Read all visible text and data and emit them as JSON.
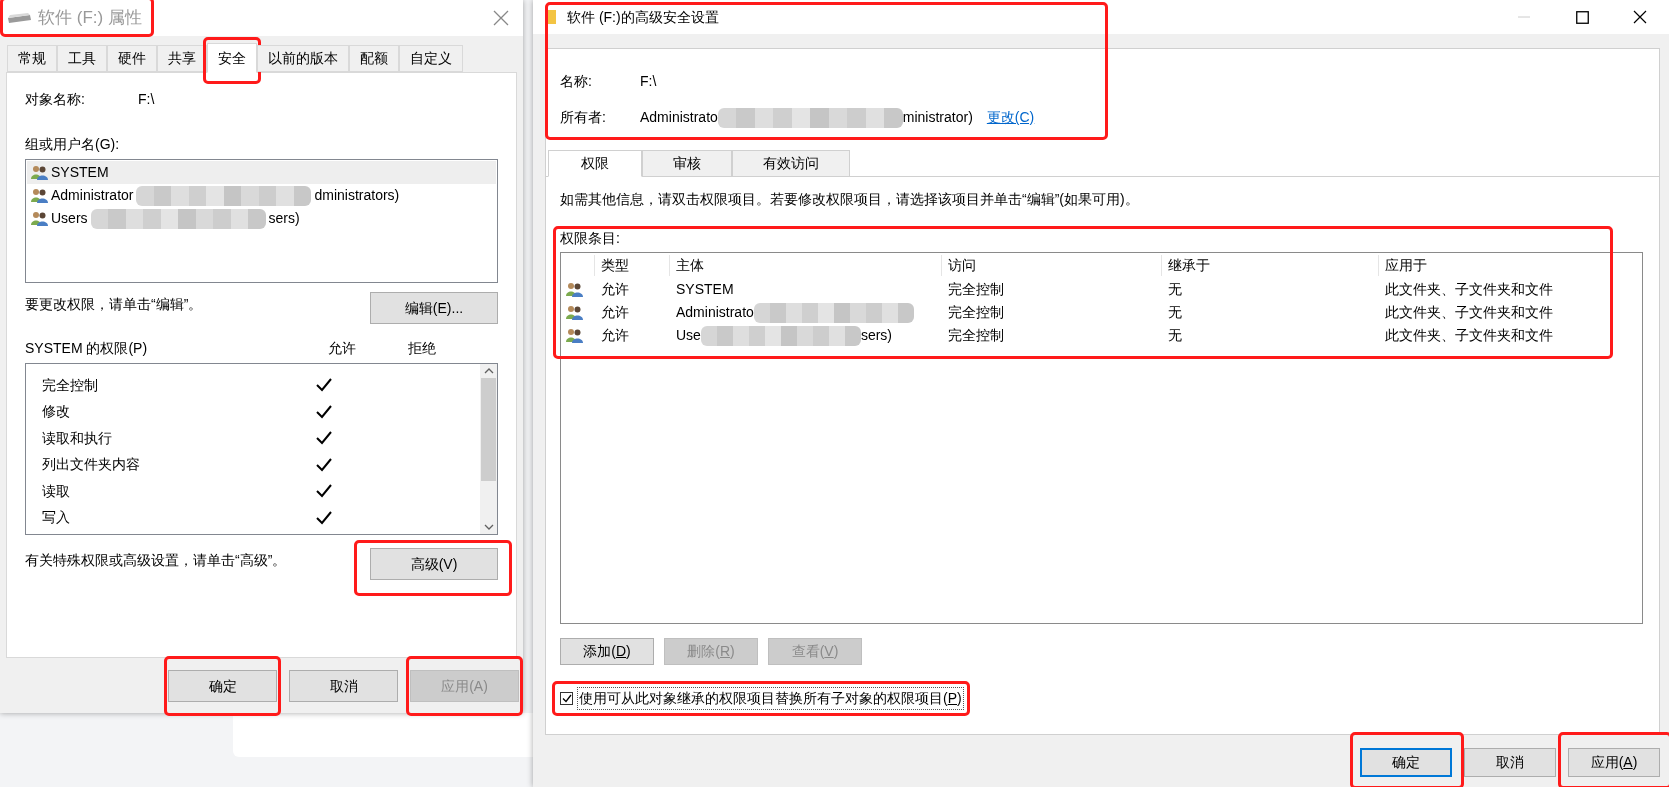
{
  "properties_dialog": {
    "title": "软件 (F:) 属性",
    "active": false,
    "title_highlighted": true,
    "tabs": [
      {
        "label": "常规",
        "selected": false,
        "highlighted": false
      },
      {
        "label": "工具",
        "selected": false,
        "highlighted": false
      },
      {
        "label": "硬件",
        "selected": false,
        "highlighted": false
      },
      {
        "label": "共享",
        "selected": false,
        "highlighted": false
      },
      {
        "label": "安全",
        "selected": true,
        "highlighted": true
      },
      {
        "label": "以前的版本",
        "selected": false,
        "highlighted": false
      },
      {
        "label": "配额",
        "selected": false,
        "highlighted": false
      },
      {
        "label": "自定义",
        "selected": false,
        "highlighted": false
      }
    ],
    "object_name": {
      "label": "对象名称:",
      "value": "F:\\"
    },
    "groups_label": "组或用户名(G):",
    "groups": [
      {
        "prefix": "SYSTEM",
        "redacted": false,
        "selected": true
      },
      {
        "prefix": "Administrator",
        "redacted": true,
        "suffix": "dministrators)",
        "selected": false
      },
      {
        "prefix": "Users",
        "redacted": true,
        "suffix": "sers)",
        "selected": false
      }
    ],
    "edit_hint": "要更改权限，请单击“编辑”。",
    "edit_button": {
      "label": "编辑(E)...",
      "highlighted": false,
      "disabled": false
    },
    "permissions_title": "SYSTEM 的权限(P)",
    "allow_header": "允许",
    "deny_header": "拒绝",
    "permissions": [
      {
        "name": "完全控制",
        "allow": true,
        "deny": false
      },
      {
        "name": "修改",
        "allow": true,
        "deny": false
      },
      {
        "name": "读取和执行",
        "allow": true,
        "deny": false
      },
      {
        "name": "列出文件夹内容",
        "allow": true,
        "deny": false
      },
      {
        "name": "读取",
        "allow": true,
        "deny": false
      },
      {
        "name": "写入",
        "allow": true,
        "deny": false
      }
    ],
    "advanced_hint": "有关特殊权限或高级设置，请单击“高级”。",
    "advanced_button": {
      "label": "高级(V)",
      "highlighted": true,
      "disabled": false
    },
    "buttons": [
      {
        "label": "确定",
        "highlighted": true,
        "disabled": false
      },
      {
        "label": "取消",
        "highlighted": false,
        "disabled": false
      },
      {
        "label": "应用(A)",
        "highlighted": true,
        "disabled": true
      }
    ]
  },
  "advanced_dialog": {
    "title": "软件 (F:)的高级安全设置",
    "header_highlighted": true,
    "name": {
      "label": "名称:",
      "value": "F:\\"
    },
    "owner": {
      "label": "所有者:",
      "prefix": "Administrato",
      "redacted": true,
      "suffix": "ministrator)",
      "link": "更改(C)"
    },
    "tabs": [
      {
        "label": "权限",
        "selected": true
      },
      {
        "label": "审核",
        "selected": false
      },
      {
        "label": "有效访问",
        "selected": false
      }
    ],
    "info": "如需其他信息，请双击权限项目。若要修改权限项目，请选择该项目并单击“编辑”(如果可用)。",
    "entries_label": "权限条目:",
    "entries_highlighted": true,
    "table": {
      "columns": [
        "类型",
        "主体",
        "访问",
        "继承于",
        "应用于"
      ],
      "rows": [
        {
          "type": "允许",
          "principal_prefix": "SYSTEM",
          "redacted": false,
          "access": "完全控制",
          "inherited_from": "无",
          "applies_to": "此文件夹、子文件夹和文件"
        },
        {
          "type": "允许",
          "principal_prefix": "Administrato",
          "redacted": true,
          "access": "完全控制",
          "inherited_from": "无",
          "applies_to": "此文件夹、子文件夹和文件"
        },
        {
          "type": "允许",
          "principal_prefix": "Use",
          "redacted": true,
          "principal_suffix": "sers)",
          "access": "完全控制",
          "inherited_from": "无",
          "applies_to": "此文件夹、子文件夹和文件"
        }
      ]
    },
    "entry_buttons": [
      {
        "before": "添加(",
        "mnemonic": "D",
        "after": ")",
        "disabled": false
      },
      {
        "before": "删除(",
        "mnemonic": "R",
        "after": ")",
        "disabled": true
      },
      {
        "before": "查看(",
        "mnemonic": "V",
        "after": ")",
        "disabled": true
      }
    ],
    "replace_checkbox": {
      "before": "使用可从此对象继承的权限项目替换所有子对象的权限项目(",
      "mnemonic": "P",
      "after": ")",
      "checked": true,
      "highlighted": true
    },
    "buttons": [
      {
        "before": "确定",
        "focused": true,
        "disabled": false,
        "highlighted": true
      },
      {
        "before": "取消",
        "focused": false,
        "disabled": false,
        "highlighted": false
      },
      {
        "before": "应用(",
        "mnemonic": "A",
        "after": ")",
        "focused": false,
        "disabled": false,
        "highlighted": true
      }
    ]
  }
}
